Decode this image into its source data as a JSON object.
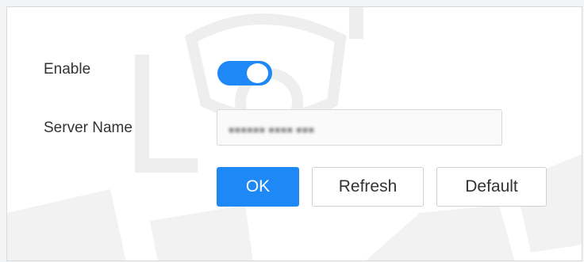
{
  "form": {
    "enable": {
      "label": "Enable",
      "checked": true
    },
    "server_name": {
      "label": "Server Name",
      "value": ""
    }
  },
  "buttons": {
    "ok": "OK",
    "refresh": "Refresh",
    "default": "Default"
  },
  "colors": {
    "accent": "#1e88f7",
    "text": "#333333",
    "border": "#d9d9d9",
    "background": "#ffffff"
  }
}
